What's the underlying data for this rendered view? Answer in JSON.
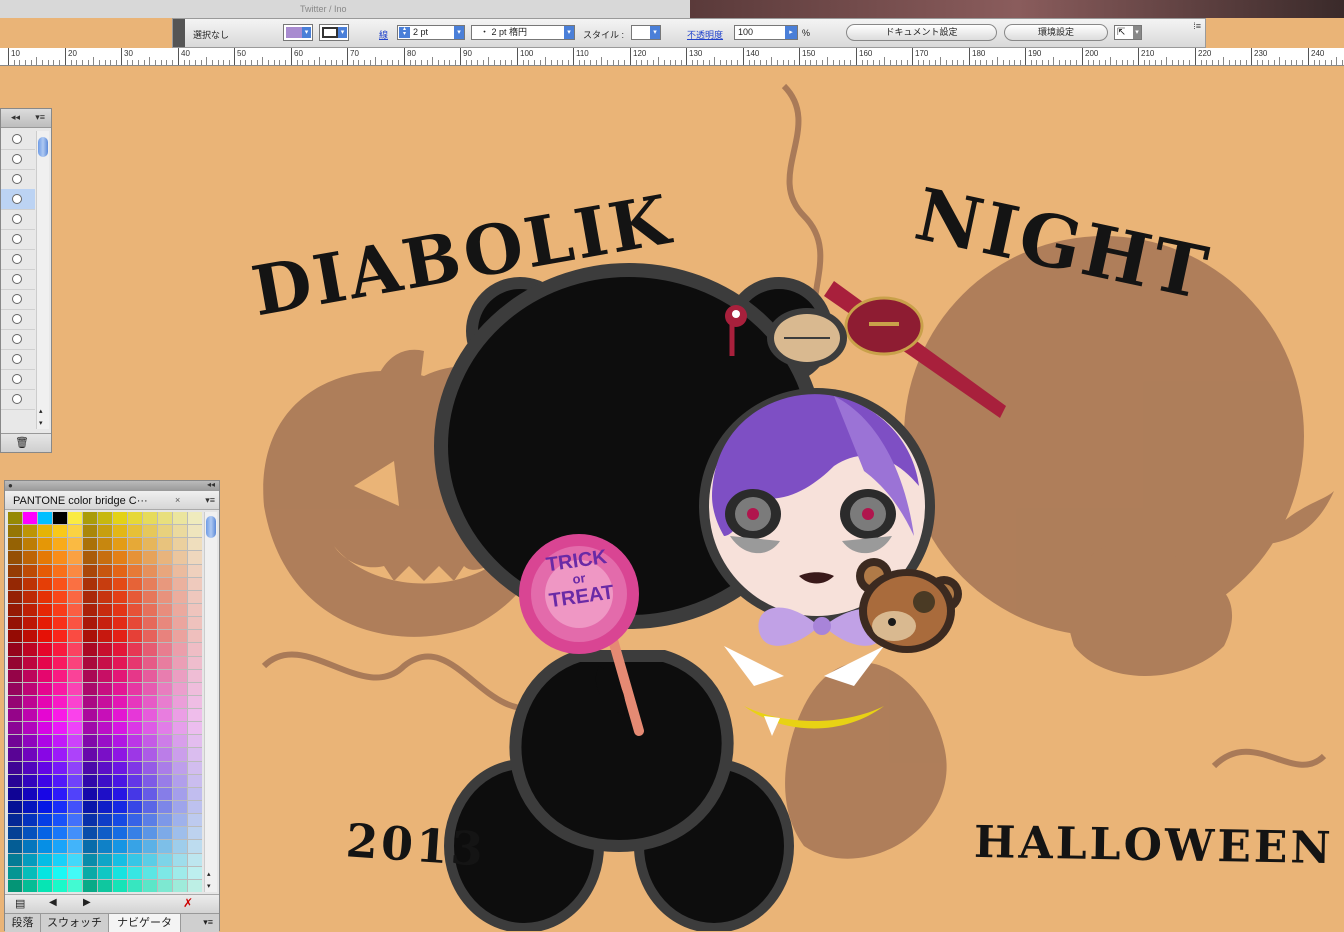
{
  "browser": {
    "tab_title": "Twitter / Ino"
  },
  "control_bar": {
    "selection_label": "選択なし",
    "fill_color": "#a88bd0",
    "stroke_label": "線",
    "stroke_weight": "2 pt",
    "brush_label": "・ 2 pt 楕円",
    "style_label": "スタイル",
    "opacity_label": "不透明度",
    "opacity_value": "100",
    "percent": "%",
    "doc_settings_button": "ドキュメント設定",
    "preferences_button": "環境設定"
  },
  "ruler": {
    "labels": [
      "10",
      "20",
      "30",
      "40",
      "50",
      "60",
      "70",
      "80",
      "90",
      "100",
      "110",
      "120",
      "130",
      "140",
      "150",
      "160",
      "170",
      "180",
      "190",
      "200",
      "210",
      "220",
      "230",
      "240"
    ]
  },
  "layers_panel": {
    "rows": 14,
    "selected_row": 3
  },
  "swatch_panel": {
    "title": "PANTONE color bridge C···",
    "tabs": [
      "段落",
      "スウォッチ",
      "ナビゲータ"
    ],
    "active_tab": "ナビゲータ"
  },
  "artwork": {
    "title_left": "DIABOLIK",
    "title_right": "NIGHT",
    "year": "2013",
    "event": "HALLOWEEN",
    "lollipop_line1": "TRICK",
    "lollipop_line2": "or",
    "lollipop_line3": "TREAT",
    "background_color": "#eab477",
    "silhouette_color": "#a97a58",
    "bear_color": "#0d0d0d",
    "hair_color": "#7e4fc4"
  }
}
